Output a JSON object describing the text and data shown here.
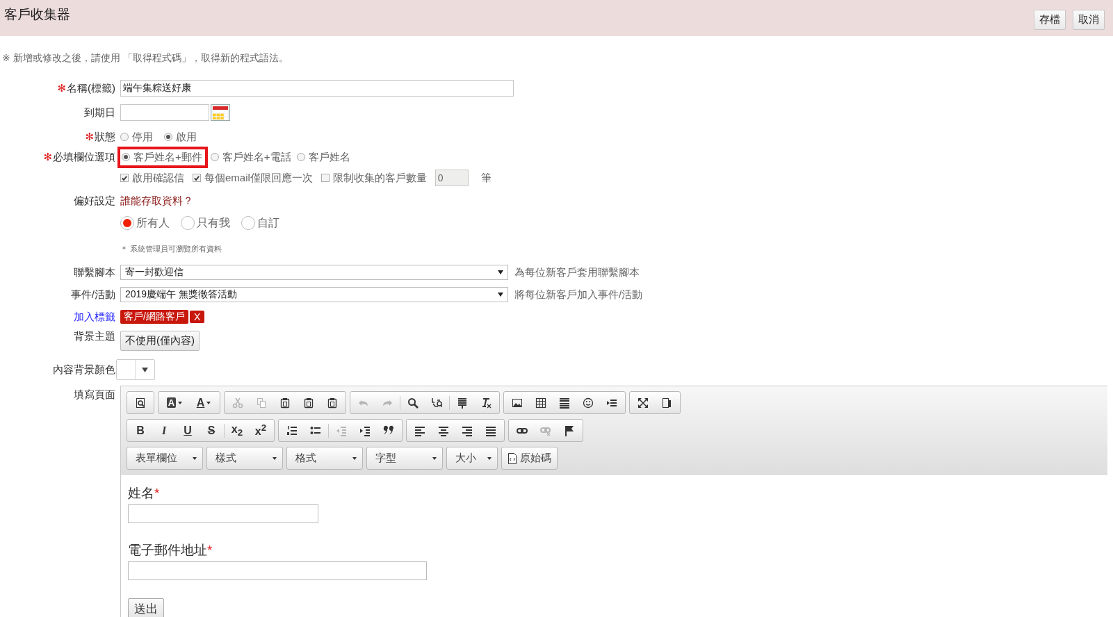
{
  "header": {
    "title": "客戶收集器",
    "buttons": [
      {
        "label": "存檔"
      },
      {
        "label": "取消"
      }
    ]
  },
  "notice": "※ 新增或修改之後，請使用 「取得程式碼」，取得新的程式語法。",
  "required_mark": "✻",
  "name": {
    "label": "名稱(標籤)",
    "required": true,
    "value": "端午集粽送好康"
  },
  "expiry": {
    "label": "到期日"
  },
  "status": {
    "label": "狀態",
    "required": true,
    "options": [
      {
        "label": "停用",
        "selected": false
      },
      {
        "label": "啟用",
        "selected": true
      }
    ]
  },
  "required_fields": {
    "label": "必填欄位選項",
    "required": true,
    "options": [
      {
        "label": "客戶姓名+郵件",
        "selected": true,
        "highlighted": true
      },
      {
        "label": "客戶姓名+電話",
        "selected": false,
        "highlighted": false
      },
      {
        "label": "客戶姓名",
        "selected": false,
        "highlighted": false
      }
    ]
  },
  "checks": [
    {
      "label": "啟用確認信",
      "checked": true
    },
    {
      "label": "每個email僅限回應一次",
      "checked": true
    },
    {
      "label": "限制收集的客戶數量",
      "checked": false
    }
  ],
  "limit": {
    "value": "0",
    "unit": "筆",
    "disabled": true
  },
  "preferences": {
    "label": "偏好設定",
    "link": "誰能存取資料？",
    "options": [
      {
        "label": "所有人",
        "selected": true
      },
      {
        "label": "只有我",
        "selected": false
      },
      {
        "label": "自訂",
        "selected": false
      }
    ],
    "note": "＊ 系統管理員可瀏覽所有資料"
  },
  "script": {
    "label": "聯繫腳本",
    "value": "寄一封歡迎信",
    "hint": "為每位新客戶套用聯繫腳本"
  },
  "event": {
    "label": "事件/活動",
    "value": "2019慶端午 無獎徵答活動",
    "hint": "將每位新客戶加入事件/活動"
  },
  "tags": {
    "link": "加入標籤",
    "items": [
      {
        "label": "客戶/網路客戶",
        "remove": "X"
      }
    ]
  },
  "theme": {
    "label": "背景主題",
    "button": "不使用(僅內容)"
  },
  "bg_color": {
    "label": "內容背景顏色",
    "color": "#ffffff"
  },
  "editor": {
    "label": "填寫頁面",
    "toolbar": [
      [
        [
          {
            "kind": "preview",
            "disabled": false
          }
        ],
        [
          {
            "kind": "bg-color",
            "label": "A",
            "disabled": false
          },
          {
            "kind": "text-color",
            "label": "A",
            "disabled": false
          }
        ],
        [
          {
            "kind": "cut",
            "disabled": true
          },
          {
            "kind": "copy",
            "disabled": true
          },
          {
            "kind": "paste",
            "disabled": false
          },
          {
            "kind": "paste-text",
            "disabled": false
          },
          {
            "kind": "paste-word",
            "disabled": false
          }
        ],
        [
          {
            "kind": "undo",
            "disabled": true
          },
          {
            "kind": "redo",
            "disabled": true
          },
          {
            "kind": "sep"
          },
          {
            "kind": "search",
            "disabled": false
          },
          {
            "kind": "replace",
            "disabled": false
          },
          {
            "kind": "sep"
          },
          {
            "kind": "select-all",
            "disabled": false
          },
          {
            "kind": "clear-format",
            "disabled": false
          }
        ],
        [
          {
            "kind": "image",
            "disabled": false
          },
          {
            "kind": "table",
            "disabled": false
          },
          {
            "kind": "rule",
            "disabled": false
          },
          {
            "kind": "smiley",
            "disabled": false
          },
          {
            "kind": "page-break",
            "disabled": false
          }
        ],
        [
          {
            "kind": "maximize",
            "disabled": false
          },
          {
            "kind": "show-blocks",
            "disabled": false
          }
        ]
      ],
      [
        [
          {
            "kind": "bold",
            "label": "B",
            "disabled": false
          },
          {
            "kind": "italic",
            "label": "I",
            "disabled": false
          },
          {
            "kind": "underline",
            "label": "U",
            "disabled": false
          },
          {
            "kind": "strike",
            "label": "S",
            "disabled": false
          },
          {
            "kind": "sep"
          },
          {
            "kind": "subscript",
            "label": "x$_{2}$",
            "disabled": false
          },
          {
            "kind": "superscript",
            "label": "x$^{2}$",
            "disabled": false
          }
        ],
        [
          {
            "kind": "numbered-list",
            "disabled": false
          },
          {
            "kind": "bullet-list",
            "disabled": false
          },
          {
            "kind": "sep"
          },
          {
            "kind": "outdent",
            "disabled": true
          },
          {
            "kind": "indent",
            "disabled": false
          },
          {
            "kind": "quote",
            "disabled": false
          }
        ],
        [
          {
            "kind": "align-left",
            "disabled": false
          },
          {
            "kind": "align-center",
            "disabled": false
          },
          {
            "kind": "align-right",
            "disabled": false
          },
          {
            "kind": "justify",
            "disabled": false
          }
        ],
        [
          {
            "kind": "link",
            "disabled": false
          },
          {
            "kind": "unlink",
            "disabled": true
          },
          {
            "kind": "anchor",
            "disabled": false
          }
        ]
      ]
    ],
    "dropdowns": [
      {
        "label": "表單欄位"
      },
      {
        "label": "樣式"
      },
      {
        "label": "格式"
      },
      {
        "label": "字型"
      },
      {
        "label": "大小"
      }
    ],
    "source_button": "原始碼",
    "content": {
      "fields": [
        {
          "label": "姓名",
          "required": true,
          "kind": "short"
        },
        {
          "label": "電子郵件地址",
          "required": true,
          "kind": "long"
        }
      ],
      "mark": "*",
      "submit": "送出"
    }
  }
}
